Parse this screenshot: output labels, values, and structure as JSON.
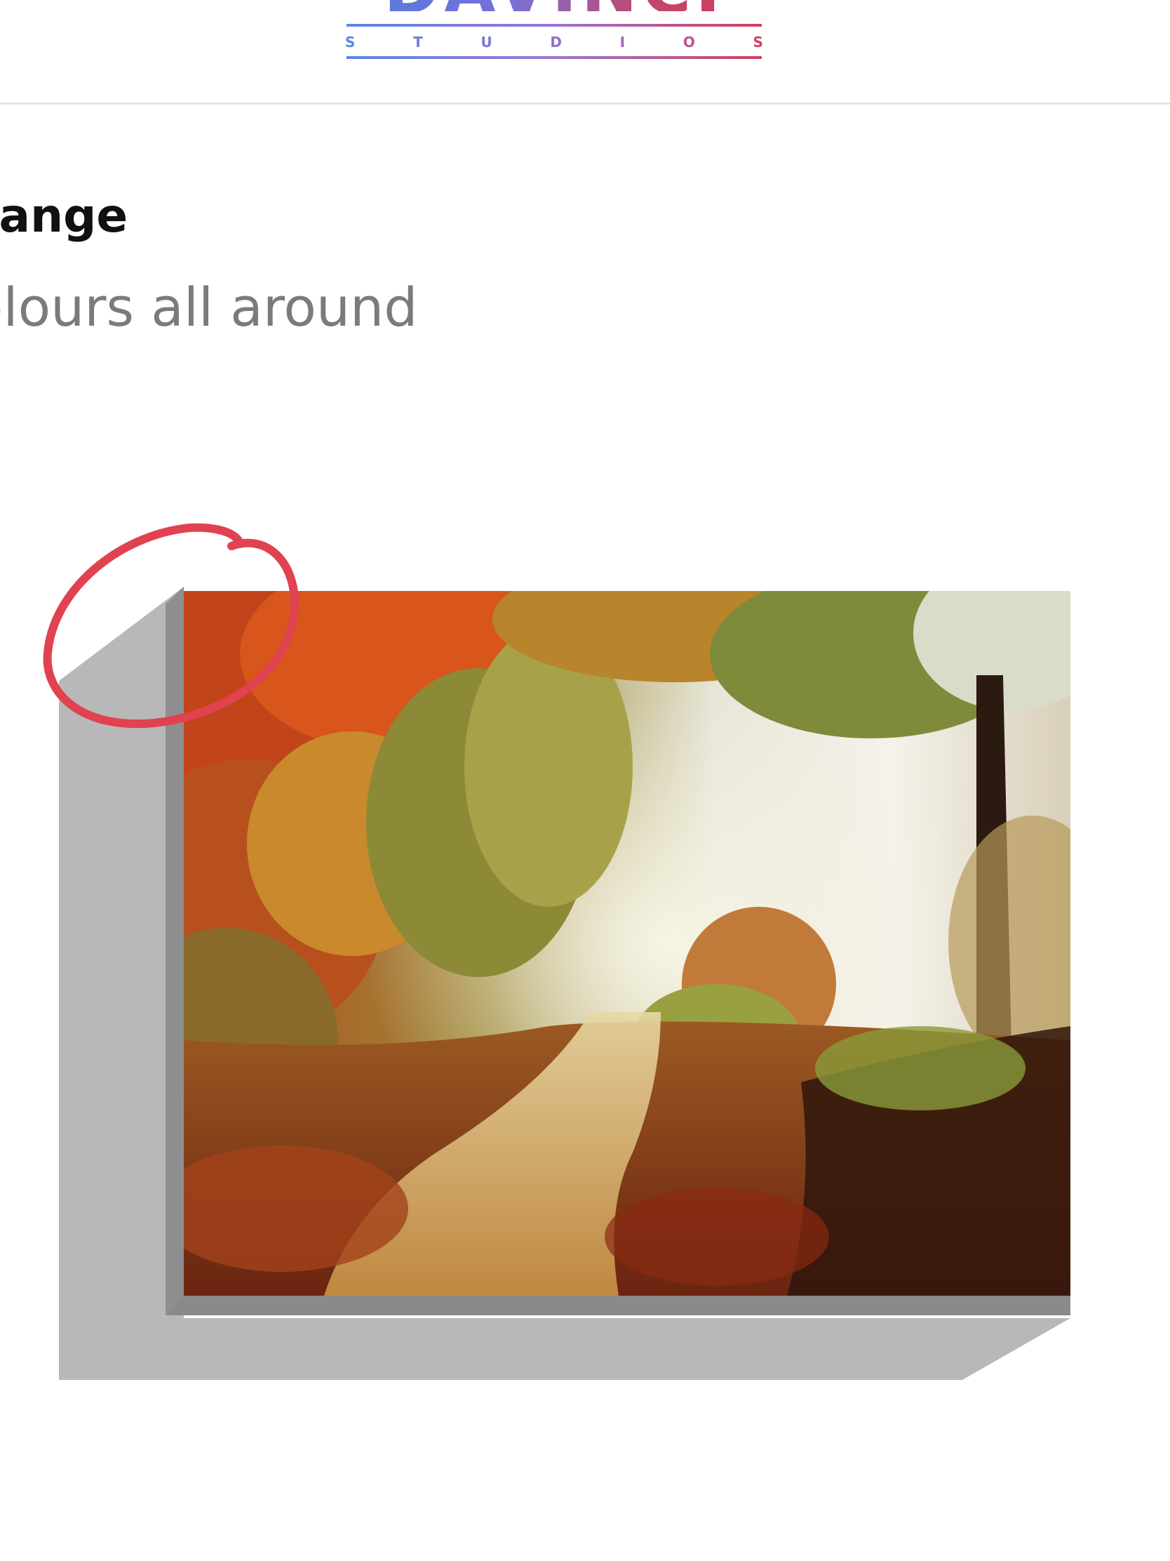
{
  "header": {
    "logo_word": "DAVINCI",
    "logo_sub_letters": [
      "S",
      "T",
      "U",
      "D",
      "I",
      "O",
      "S"
    ]
  },
  "product": {
    "title": "range",
    "subtitle": "olours all around"
  },
  "canvas": {
    "image_name": "autumn-forest-path",
    "shadow_color": "#b6b6b6",
    "edge_color": "#8c8c8c"
  },
  "annotation": {
    "color": "#e0424f",
    "icon": "red-circle-annotation"
  }
}
